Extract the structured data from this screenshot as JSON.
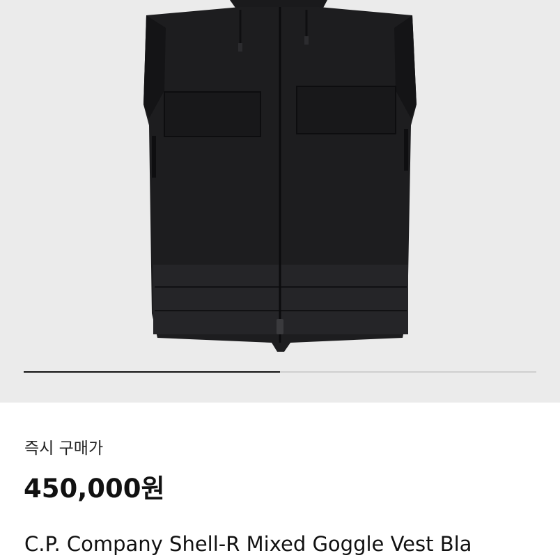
{
  "gallery": {
    "slide_progress": 0.5,
    "image_alt": "vest-product-photo"
  },
  "product": {
    "price_label": "즉시 구매가",
    "price": "450,000원",
    "title": "C.P. Company Shell-R Mixed Goggle Vest Bla"
  },
  "colors": {
    "hero_background": "#ebebeb",
    "garment": "#1c1c1e",
    "progress_active": "#111111",
    "progress_track": "#cfcfcf"
  }
}
